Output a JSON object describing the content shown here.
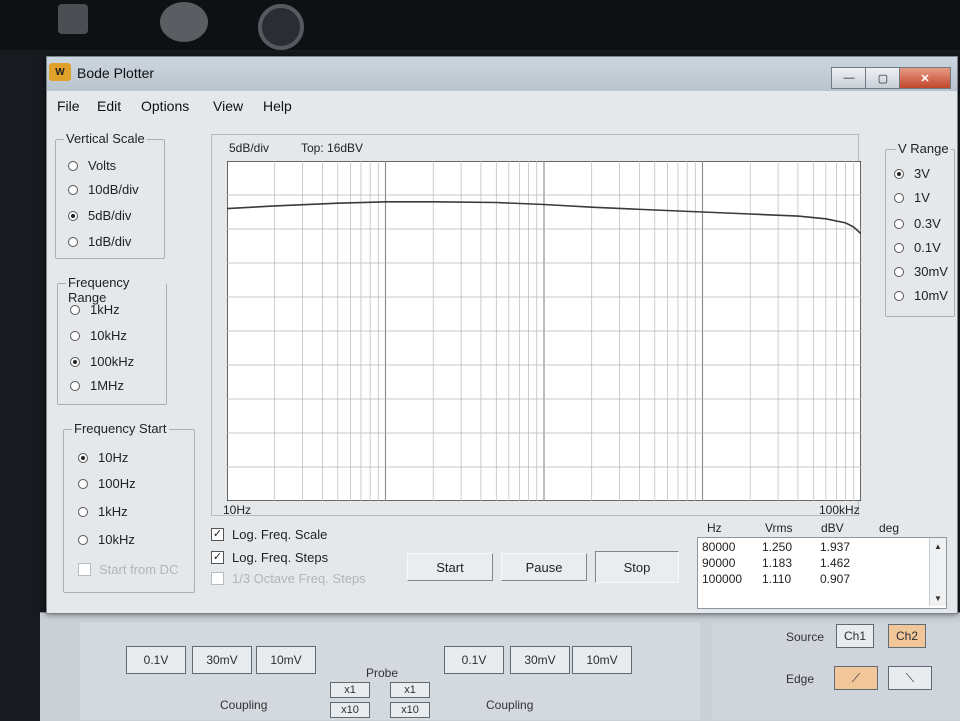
{
  "window": {
    "title": "Bode Plotter",
    "app_icon_text": "W"
  },
  "window_controls": {
    "minimize": "—",
    "maximize": "▢",
    "close": "✕"
  },
  "menu": [
    "File",
    "Edit",
    "Options",
    "View",
    "Help"
  ],
  "vertical_scale": {
    "title": "Vertical Scale",
    "options": [
      {
        "label": "Volts",
        "selected": false
      },
      {
        "label": "10dB/div",
        "selected": false
      },
      {
        "label": "5dB/div",
        "selected": true
      },
      {
        "label": "1dB/div",
        "selected": false
      }
    ]
  },
  "frequency_range": {
    "title": "Frequency Range",
    "options": [
      {
        "label": "1kHz",
        "selected": false
      },
      {
        "label": "10kHz",
        "selected": false
      },
      {
        "label": "100kHz",
        "selected": true
      },
      {
        "label": "1MHz",
        "selected": false
      }
    ]
  },
  "frequency_start": {
    "title": "Frequency Start",
    "options": [
      {
        "label": "10Hz",
        "selected": true
      },
      {
        "label": "100Hz",
        "selected": false
      },
      {
        "label": "1kHz",
        "selected": false
      },
      {
        "label": "10kHz",
        "selected": false
      }
    ],
    "start_from_dc": {
      "label": "Start from DC",
      "checked": false,
      "enabled": false
    }
  },
  "v_range": {
    "title": "V Range",
    "options": [
      {
        "label": "3V",
        "selected": true
      },
      {
        "label": "1V",
        "selected": false
      },
      {
        "label": "0.3V",
        "selected": false
      },
      {
        "label": "0.1V",
        "selected": false
      },
      {
        "label": "30mV",
        "selected": false
      },
      {
        "label": "10mV",
        "selected": false
      }
    ]
  },
  "plot": {
    "scale_text": "5dB/div",
    "top_text": "Top:  16dBV"
  },
  "options": [
    {
      "label": "Log. Freq. Scale",
      "checked": true,
      "enabled": true
    },
    {
      "label": "Log. Freq. Steps",
      "checked": true,
      "enabled": true
    },
    {
      "label": "1/3 Octave Freq. Steps",
      "checked": false,
      "enabled": false
    }
  ],
  "buttons": {
    "start": "Start",
    "pause": "Pause",
    "stop": "Stop"
  },
  "readout": {
    "headers": [
      "Hz",
      "Vrms",
      "dBV",
      "deg"
    ],
    "rows": [
      [
        "80000",
        "1.250",
        "1.937",
        ""
      ],
      [
        "90000",
        "1.183",
        "1.462",
        ""
      ],
      [
        "100000",
        "1.110",
        "0.907",
        ""
      ]
    ]
  },
  "background_app": {
    "range_buttons_left": [
      "0.1V",
      "30mV",
      "10mV"
    ],
    "range_buttons_right": [
      "0.1V",
      "30mV",
      "10mV"
    ],
    "probe_label": "Probe",
    "probe_buttons": [
      "x1",
      "x1",
      "x10",
      "x10"
    ],
    "coupling_label": "Coupling",
    "source_label": "Source",
    "source_buttons": [
      "Ch1",
      "Ch2"
    ],
    "edge_label": "Edge"
  },
  "chart_data": {
    "type": "line",
    "x_scale": "log",
    "xlim": [
      10,
      100000
    ],
    "ylim": [
      -34,
      16
    ],
    "x_tick_labels": [
      "10Hz",
      "100kHz"
    ],
    "grid": true,
    "series": [
      {
        "x": [
          10,
          20,
          50,
          100,
          200,
          500,
          1000,
          2000,
          5000,
          10000,
          20000,
          40000,
          60000,
          80000,
          90000,
          100000
        ],
        "y": [
          9.0,
          9.4,
          9.8,
          10.0,
          10.0,
          9.9,
          9.6,
          9.2,
          8.8,
          8.5,
          8.2,
          7.9,
          7.5,
          6.9,
          6.3,
          5.3
        ]
      }
    ]
  }
}
